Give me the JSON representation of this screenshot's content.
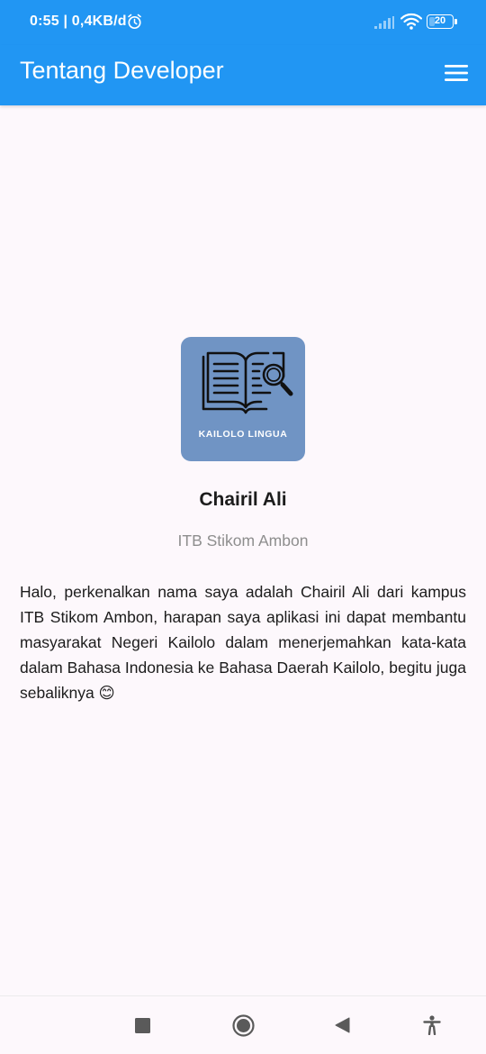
{
  "status_bar": {
    "time": "0:55 | 0,4KB/d",
    "battery_level": "20",
    "icons": [
      "alarm-icon",
      "signal-icon",
      "wifi-icon",
      "battery-icon"
    ]
  },
  "app_bar": {
    "title": "Tentang Developer",
    "menu_icon": "hamburger-menu-icon",
    "background_color": "#2196f3"
  },
  "logo": {
    "text": "KAILOLO LINGUA",
    "icon": "book-magnifier-icon",
    "background_color": "#7094c4"
  },
  "profile": {
    "name": "Chairil Ali",
    "institution": "ITB Stikom Ambon",
    "bio": "Halo, perkenalkan nama saya adalah Chairil Ali dari kampus ITB Stikom Ambon, harapan saya aplikasi ini dapat membantu masyarakat Negeri Kailolo dalam menerjemahkan kata-kata dalam Bahasa Indonesia ke Bahasa Daerah Kailolo, begitu juga sebaliknya 😊"
  },
  "nav_bar": {
    "buttons": [
      "recents-button",
      "home-button",
      "back-button",
      "accessibility-button"
    ]
  }
}
